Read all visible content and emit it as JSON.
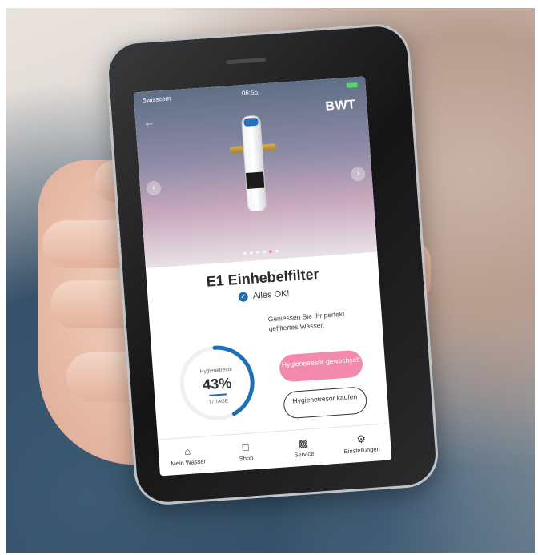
{
  "status_bar": {
    "carrier": "Swisscom",
    "time": "06:55"
  },
  "header": {
    "logo": "BWT"
  },
  "product": {
    "name": "E1 Einhebelfilter",
    "status": "Alles OK!"
  },
  "message": "Geniessen Sie Ihr perfekt gefiltertes Wasser.",
  "gauge": {
    "label": "Hygienetresor",
    "value": "43%",
    "percent": 43,
    "days": "77 TAGE"
  },
  "buttons": {
    "changed": "Hygienetresor gewechselt",
    "buy": "Hygienetresor kaufen"
  },
  "carousel": {
    "total": 6,
    "active": 5
  },
  "tabs": [
    {
      "label": "Mein Wasser",
      "icon": "home-icon"
    },
    {
      "label": "Shop",
      "icon": "shopping-bag-icon"
    },
    {
      "label": "Service",
      "icon": "chat-icon"
    },
    {
      "label": "Einstellungen",
      "icon": "gear-icon"
    }
  ],
  "colors": {
    "accent_blue": "#1f6fb5",
    "accent_pink": "#f28bab"
  }
}
